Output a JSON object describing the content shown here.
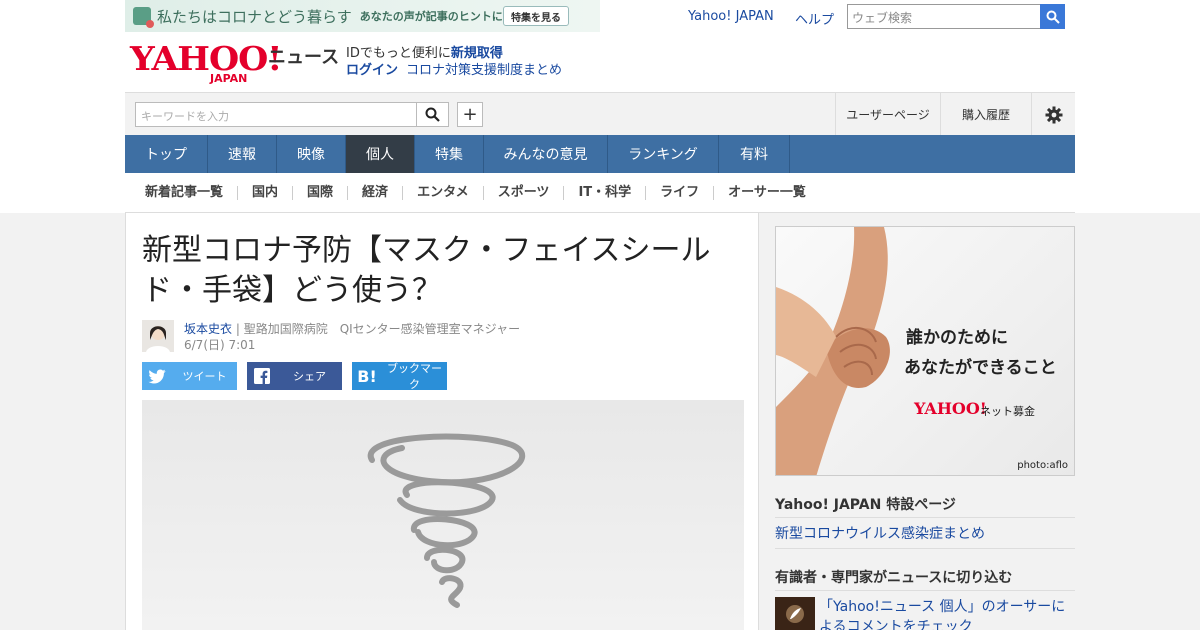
{
  "banner": {
    "title": "私たちはコロナとどう暮らす",
    "subtitle": "あなたの声が記事のヒントに",
    "button": "特集を見る"
  },
  "top_links": {
    "yahoo_japan": "Yahoo! JAPAN",
    "help": "ヘルプ",
    "web_search_placeholder": "ウェブ検索"
  },
  "logo": {
    "yahoo": "YAHOO!",
    "japan": "JAPAN",
    "news": "ニュース"
  },
  "id_promo": {
    "text": "IDでもっと便利に",
    "signup": "新規取得",
    "login": "ログイン",
    "corona_link": "コロナ対策支援制度まとめ"
  },
  "toolbar": {
    "keyword_placeholder": "キーワードを入力",
    "user_page": "ユーザーページ",
    "purchase_history": "購入履歴"
  },
  "nav": [
    {
      "label": "トップ",
      "active": false
    },
    {
      "label": "速報",
      "active": false
    },
    {
      "label": "映像",
      "active": false
    },
    {
      "label": "個人",
      "active": true
    },
    {
      "label": "特集",
      "active": false
    },
    {
      "label": "みんなの意見",
      "active": false
    },
    {
      "label": "ランキング",
      "active": false
    },
    {
      "label": "有料",
      "active": false
    }
  ],
  "subnav": [
    {
      "label": "新着記事一覧",
      "active": false
    },
    {
      "label": "国内",
      "active": false
    },
    {
      "label": "国際",
      "active": false
    },
    {
      "label": "経済",
      "active": false
    },
    {
      "label": "エンタメ",
      "active": false
    },
    {
      "label": "スポーツ",
      "active": false
    },
    {
      "label": "IT・科学",
      "active": false
    },
    {
      "label": "ライフ",
      "active": true
    },
    {
      "label": "オーサー一覧",
      "active": false
    }
  ],
  "article": {
    "headline_line1": "新型コロナ予防【マスク・フェイスシール",
    "headline_line2": "ド・手袋】どう使う？",
    "author_name": "坂本史衣",
    "author_affiliation": " | 聖路加国際病院　QIセンター感染管理室マネジャー",
    "date": "6/7(日) 7:01"
  },
  "share": {
    "twitter": "ツイート",
    "facebook": "シェア",
    "hatena": "ブックマーク",
    "hatena_icon": "B!"
  },
  "ad": {
    "line1": "誰かのために",
    "line2": "あなたができること",
    "logo": "YAHOO!",
    "logo_sub": "ネット募金",
    "credit": "photo:aflo"
  },
  "sidebar": {
    "special_heading": "Yahoo! JAPAN 特設ページ",
    "special_link": "新型コロナウイルス感染症まとめ",
    "experts_heading": "有識者・専門家がニュースに切り込む",
    "experts_link": "「Yahoo!ニュース 個人」のオーサーによるコメントをチェック"
  },
  "colors": {
    "nav_bg": "#3e6fa3",
    "nav_active": "#333d47",
    "link": "#1a4aa0",
    "brand_red": "#e4002b",
    "twitter": "#55acee",
    "facebook": "#3b5998",
    "hatena": "#2b8fd8"
  }
}
